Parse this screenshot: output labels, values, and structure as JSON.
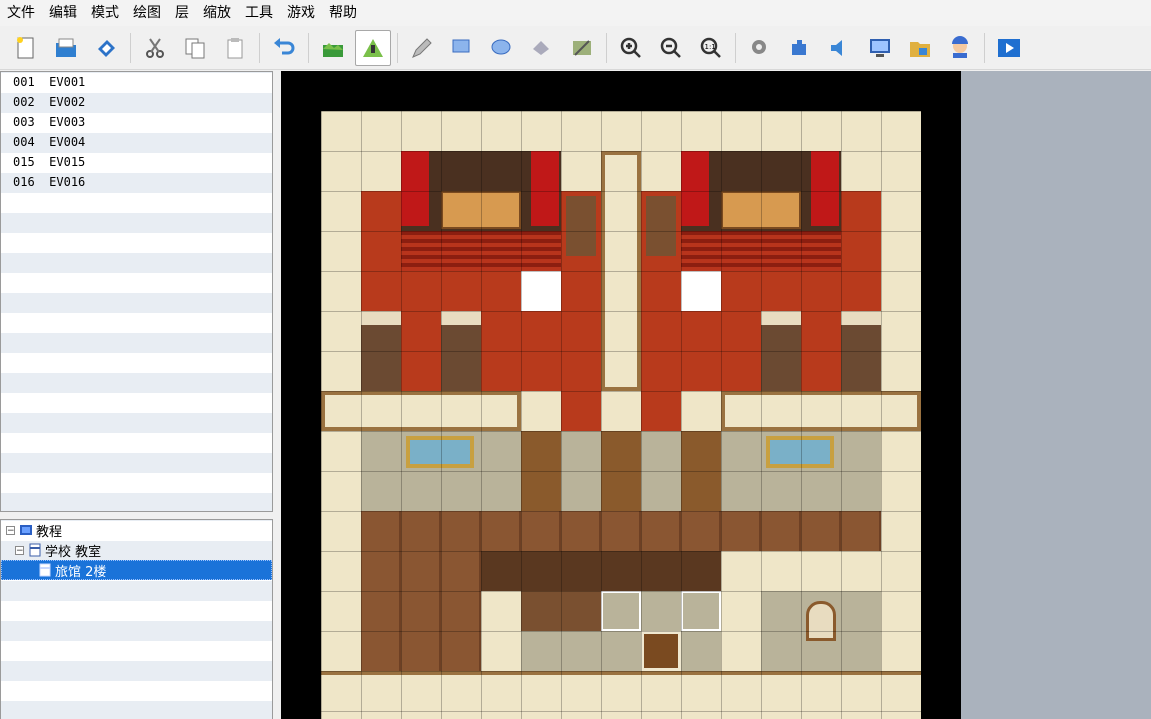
{
  "menu": [
    "文件",
    "编辑",
    "模式",
    "绘图",
    "层",
    "缩放",
    "工具",
    "游戏",
    "帮助"
  ],
  "toolbar": {
    "buttons": [
      {
        "name": "new-project-icon"
      },
      {
        "name": "open-project-icon"
      },
      {
        "name": "save-project-icon"
      },
      {
        "sep": true
      },
      {
        "name": "cut-icon"
      },
      {
        "name": "copy-icon"
      },
      {
        "name": "paste-icon"
      },
      {
        "sep": true
      },
      {
        "name": "undo-icon"
      },
      {
        "sep": true
      },
      {
        "name": "map-mode-icon"
      },
      {
        "name": "event-mode-icon",
        "active": true
      },
      {
        "sep": true
      },
      {
        "name": "pencil-icon"
      },
      {
        "name": "rectangle-icon"
      },
      {
        "name": "ellipse-icon"
      },
      {
        "name": "fill-icon"
      },
      {
        "name": "shadow-pen-icon"
      },
      {
        "sep": true
      },
      {
        "name": "zoom-in-icon"
      },
      {
        "name": "zoom-out-icon"
      },
      {
        "name": "zoom-actual-icon"
      },
      {
        "sep": true
      },
      {
        "name": "database-icon"
      },
      {
        "name": "plugin-manager-icon"
      },
      {
        "name": "sound-test-icon"
      },
      {
        "name": "event-searcher-icon"
      },
      {
        "name": "resource-manager-icon"
      },
      {
        "name": "character-generator-icon"
      },
      {
        "sep": true
      },
      {
        "name": "playtest-icon"
      }
    ]
  },
  "events": [
    {
      "id": "001",
      "name": "EV001"
    },
    {
      "id": "002",
      "name": "EV002"
    },
    {
      "id": "003",
      "name": "EV003"
    },
    {
      "id": "004",
      "name": "EV004"
    },
    {
      "id": "015",
      "name": "EV015"
    },
    {
      "id": "016",
      "name": "EV016"
    }
  ],
  "map_tree": {
    "project": "教程",
    "maps": [
      {
        "label": "学校 教室",
        "level": 1,
        "selected": false
      },
      {
        "label": "旅馆 2楼",
        "level": 2,
        "selected": true
      }
    ]
  },
  "colors": {
    "wall_cream": "#efe6c8",
    "wall_frame": "#9a7240",
    "carpet_red": "#b83a1c",
    "wood_floor": "#8a5632",
    "stone_floor": "#b9b39a",
    "selection_blue": "#1a73d9"
  }
}
